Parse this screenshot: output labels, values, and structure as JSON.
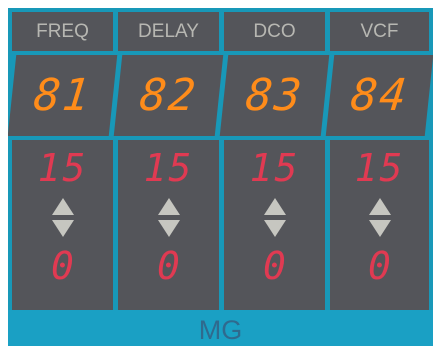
{
  "colors": {
    "panel": "#1898b8",
    "cell": "#54555a",
    "header_text": "#b7b7b2",
    "value_text": "#ff8c1a",
    "range_text": "#e03a52",
    "arrow": "#c6c6c0"
  },
  "columns": [
    {
      "header": "FREQ",
      "value": "81",
      "max": "15",
      "min": "0"
    },
    {
      "header": "DELAY",
      "value": "82",
      "max": "15",
      "min": "0"
    },
    {
      "header": "DCO",
      "value": "83",
      "max": "15",
      "min": "0"
    },
    {
      "header": "VCF",
      "value": "84",
      "max": "15",
      "min": "0"
    }
  ],
  "section_label": "MG"
}
